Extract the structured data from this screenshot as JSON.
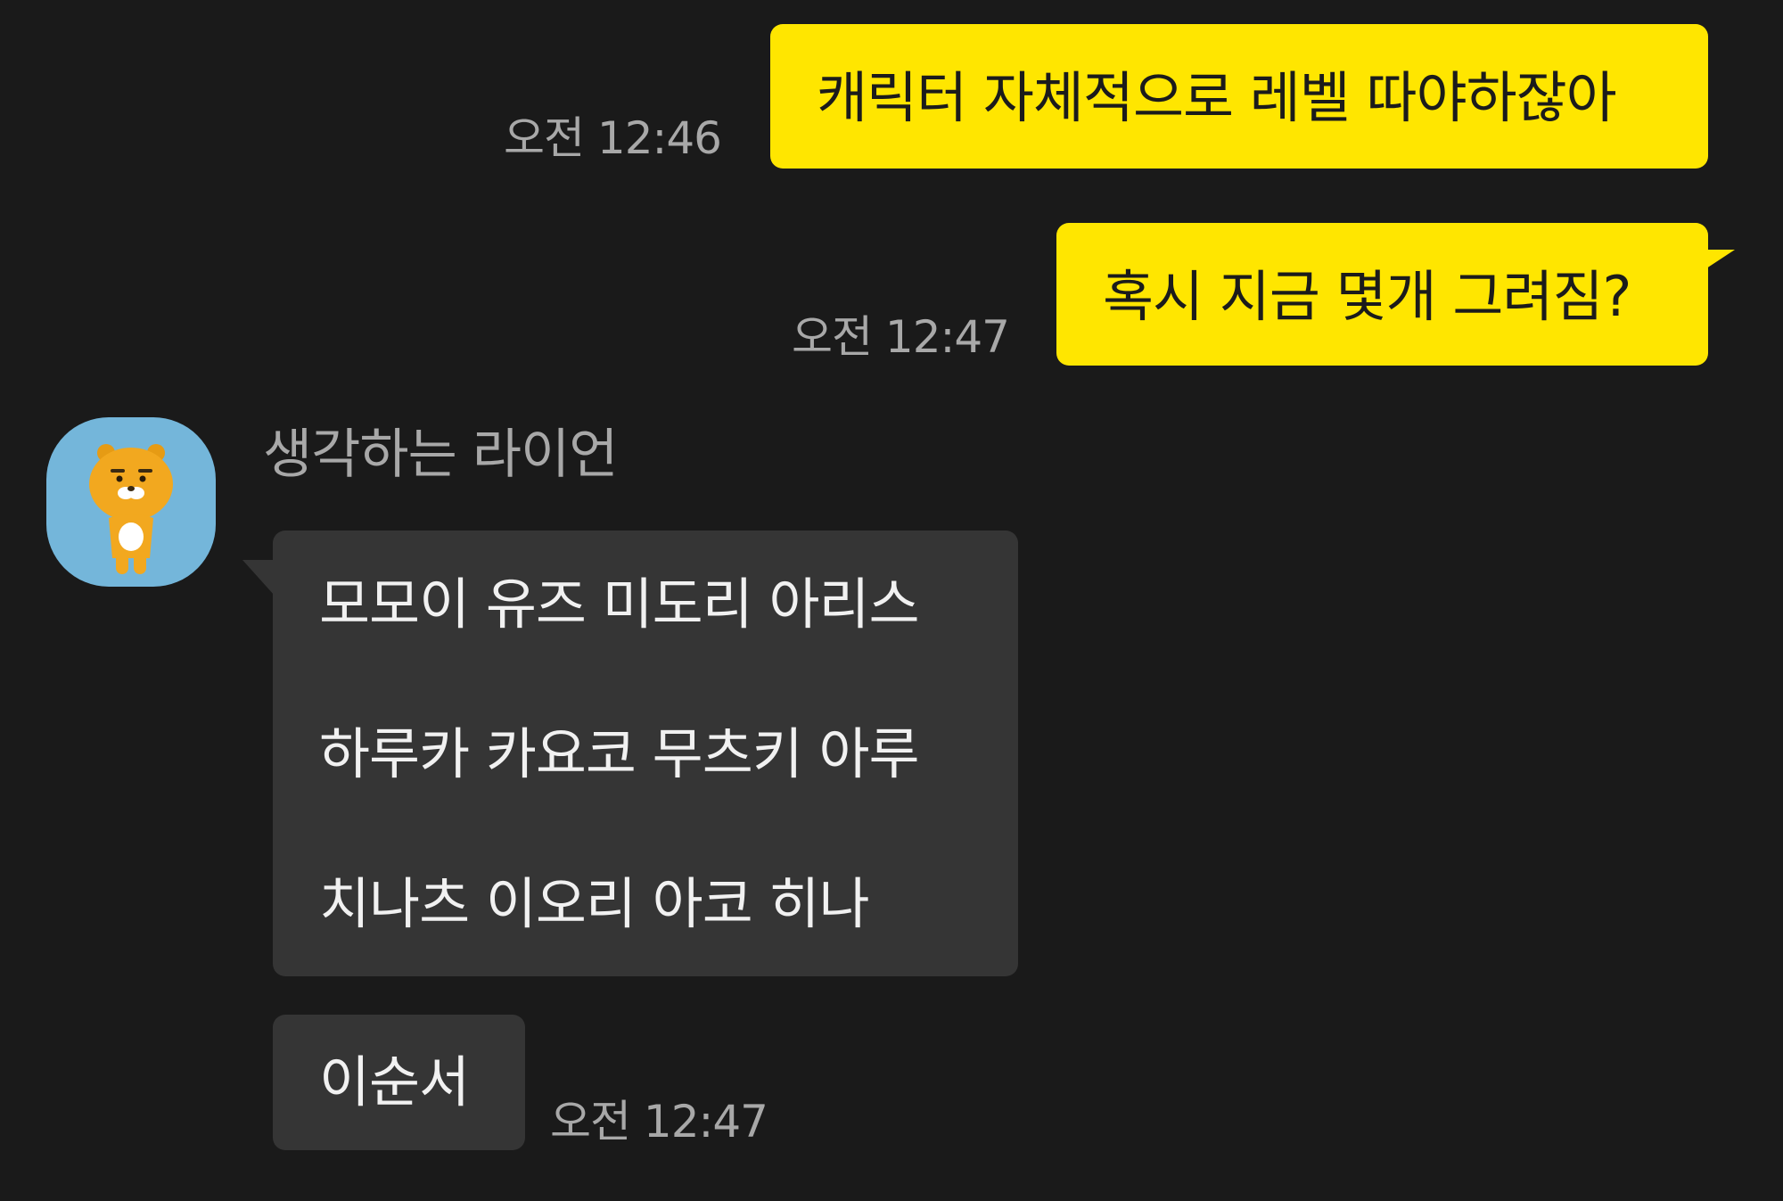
{
  "chat": {
    "messages": [
      {
        "id": "m1",
        "sender": "me",
        "text": "캐릭터 자체적으로 레벨 따야하잖아",
        "time": "오전 12:46"
      },
      {
        "id": "m2",
        "sender": "me",
        "text": "혹시 지금 몇개 그려짐?",
        "time": "오전 12:47"
      },
      {
        "id": "m3",
        "sender": "other",
        "lines": [
          "모모이 유즈 미도리 아리스",
          "하루카 카요코 무츠키 아루",
          "치나츠 이오리 아코 히나"
        ]
      },
      {
        "id": "m4",
        "sender": "other",
        "text": "이순서",
        "time": "오전 12:47"
      }
    ],
    "other_user": {
      "name": "생각하는 라이언",
      "avatar_icon": "ryan-lion-avatar-icon"
    }
  },
  "colors": {
    "background": "#1a1a1a",
    "my_bubble": "#ffe600",
    "other_bubble": "#353535",
    "time_text": "#a8a8a8",
    "avatar_bg": "#74b6da"
  }
}
